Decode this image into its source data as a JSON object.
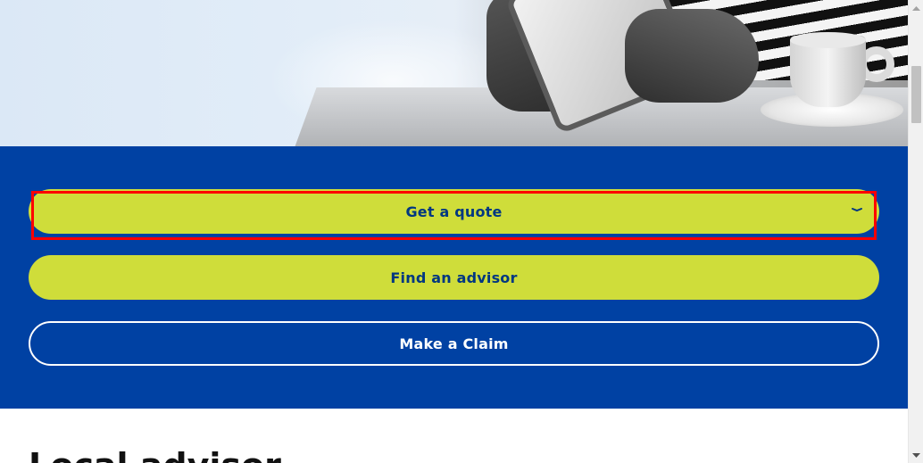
{
  "hero": {
    "image_alt": "Person using a tablet with a cup of coffee"
  },
  "cta": {
    "get_quote_label": "Get a quote",
    "find_advisor_label": "Find an advisor",
    "make_claim_label": "Make a Claim"
  },
  "next_section": {
    "heading_partial": "Local advisor"
  },
  "colors": {
    "band_blue": "#0041a3",
    "lime": "#cfdd3a",
    "button_text_blue": "#003781",
    "highlight_red": "#ff0000"
  },
  "icons": {
    "quote_toggle": "chevron-down-icon",
    "scroll_up": "scroll-up-arrow-icon",
    "scroll_down": "scroll-down-arrow-icon"
  }
}
